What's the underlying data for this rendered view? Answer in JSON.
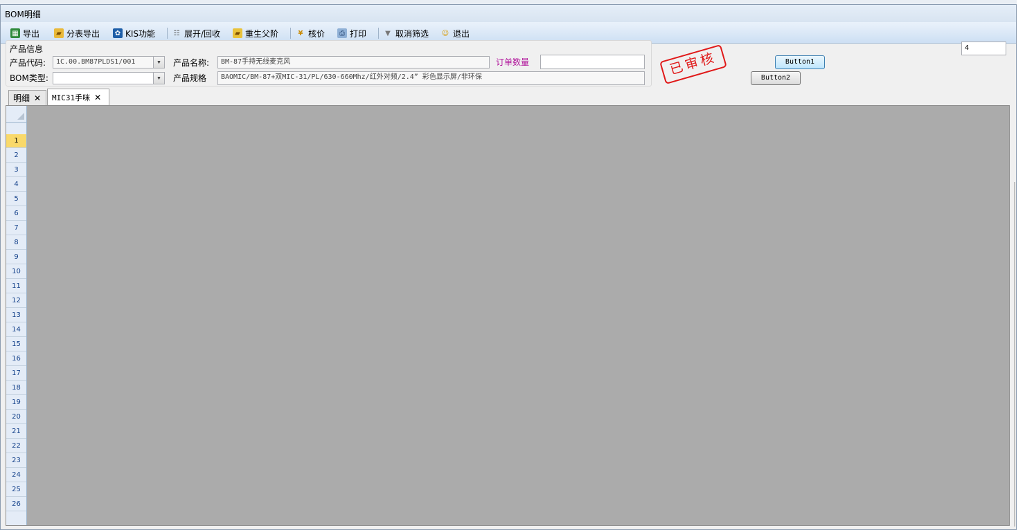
{
  "window": {
    "title": "BOM明细"
  },
  "toolbar": {
    "items": [
      {
        "label": "导出",
        "icon": "excel-export-icon"
      },
      {
        "label": "分表导出",
        "icon": "folder-export-icon"
      },
      {
        "label": "KIS功能",
        "icon": "kis-gear-icon"
      },
      {
        "label": "展开/回收",
        "icon": "tree-expand-icon"
      },
      {
        "label": "重生父阶",
        "icon": "folder-refresh-icon"
      },
      {
        "label": "核价",
        "icon": "yen-icon"
      },
      {
        "label": "打印",
        "icon": "printer-icon"
      },
      {
        "label": "取消筛选",
        "icon": "filter-clear-icon"
      },
      {
        "label": "退出",
        "icon": "exit-person-icon"
      }
    ]
  },
  "product_info": {
    "group_title": "产品信息",
    "code_label": "产品代码:",
    "code_value": "1C.00.BM87PLDS1/001",
    "name_label": "产品名称:",
    "name_value": "BM-87手持无线麦克风",
    "order_qty_label": "订单数量",
    "order_qty_value": "",
    "bom_type_label": "BOM类型:",
    "bom_type_value": "",
    "spec_label": "产品规格",
    "spec_value": "BAOMIC/BM-87+双MIC-31/PL/630-660Mhz/红外对频/2.4” 彩色显示屏/非环保"
  },
  "stamp": {
    "text": "已审核",
    "color": "#e01818"
  },
  "buttons": {
    "button1": "Button1",
    "button2": "Button2"
  },
  "numbox": {
    "value": "4"
  },
  "tabs": [
    {
      "label": "明细",
      "close": "✕",
      "active": false
    },
    {
      "label": "MIC31手咪",
      "close": "✕",
      "active": true
    }
  ],
  "grid": {
    "selected_row": "1",
    "rows": [
      "1",
      "2",
      "3",
      "4",
      "5",
      "6",
      "7",
      "8",
      "9",
      "10",
      "11",
      "12",
      "13",
      "14",
      "15",
      "16",
      "17",
      "18",
      "19",
      "20",
      "21",
      "22",
      "23",
      "24",
      "25",
      "26"
    ]
  }
}
